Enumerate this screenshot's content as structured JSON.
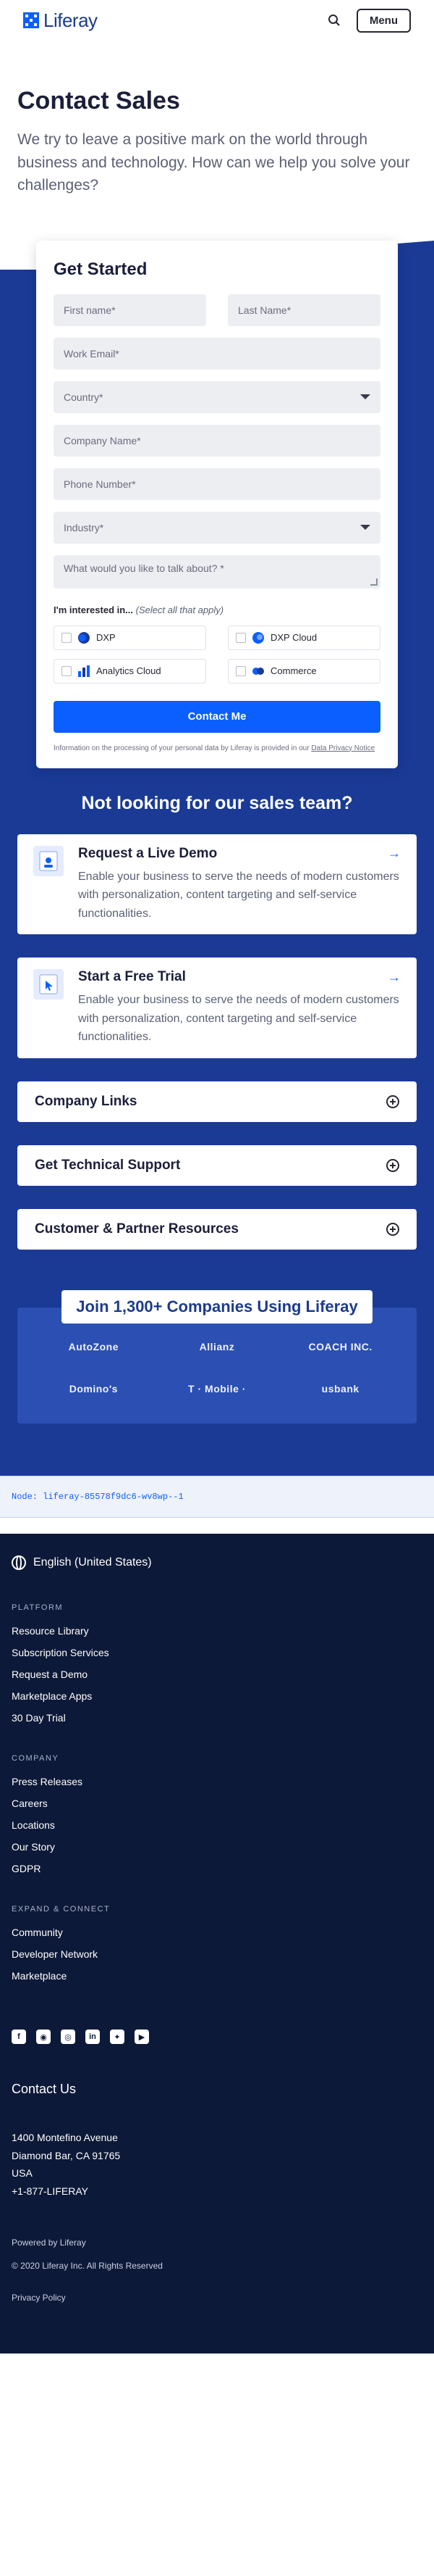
{
  "header": {
    "logo_text": "Liferay",
    "menu_label": "Menu"
  },
  "hero": {
    "title": "Contact Sales",
    "subtitle": "We try to leave a positive mark on the world through business and technology. How can we help you solve your challenges?"
  },
  "form": {
    "title": "Get Started",
    "first_name": "First name*",
    "last_name": "Last Name*",
    "work_email": "Work Email*",
    "country": "Country*",
    "company_name": "Company Name*",
    "phone": "Phone Number*",
    "industry": "Industry*",
    "talk_about": "What would you like to talk about? *",
    "interested_label": "I'm interested in...",
    "interested_hint": "(Select all that apply)",
    "products": [
      "DXP",
      "DXP Cloud",
      "Analytics Cloud",
      "Commerce"
    ],
    "submit": "Contact Me",
    "privacy_text": "Information on the processing of your personal data by Liferay is provided in our",
    "privacy_link": "Data Privacy Notice"
  },
  "not_looking": "Not looking for our sales team?",
  "cards": [
    {
      "title": "Request a Live Demo",
      "desc": "Enable your business to serve the needs of modern customers with personalization, content targeting and self-service functionalities."
    },
    {
      "title": "Start a Free Trial",
      "desc": "Enable your business to serve the needs of modern customers with personalization, content targeting and self-service functionalities."
    }
  ],
  "accordions": [
    "Company Links",
    "Get Technical Support",
    "Customer & Partner Resources"
  ],
  "companies": {
    "title": "Join 1,300+ Companies Using Liferay",
    "logos": [
      "AutoZone",
      "Allianz",
      "COACH INC.",
      "Domino's",
      "T · Mobile ·",
      "usbank"
    ]
  },
  "node": "Node: liferay-85578f9dc6-wv8wp--1",
  "footer": {
    "language": "English (United States)",
    "platform_head": "PLATFORM",
    "platform_links": [
      "Resource Library",
      "Subscription Services",
      "Request a Demo",
      "Marketplace Apps",
      "30 Day Trial"
    ],
    "company_head": "COMPANY",
    "company_links": [
      "Press Releases",
      "Careers",
      "Locations",
      "Our Story",
      "GDPR"
    ],
    "expand_head": "EXPAND & CONNECT",
    "expand_links": [
      "Community",
      "Developer Network",
      "Marketplace"
    ],
    "contact_us": "Contact Us",
    "address": [
      "1400 Montefino Avenue",
      "Diamond Bar, CA 91765",
      "USA",
      "+1-877-LIFERAY"
    ],
    "powered_by": "Powered by Liferay",
    "copyright": "© 2020 Liferay Inc. All Rights Reserved",
    "privacy_policy": "Privacy Policy"
  },
  "colors": {
    "accent": "#0b5fff",
    "brand_dark": "#1a3a96",
    "footer_bg": "#0d1938"
  }
}
